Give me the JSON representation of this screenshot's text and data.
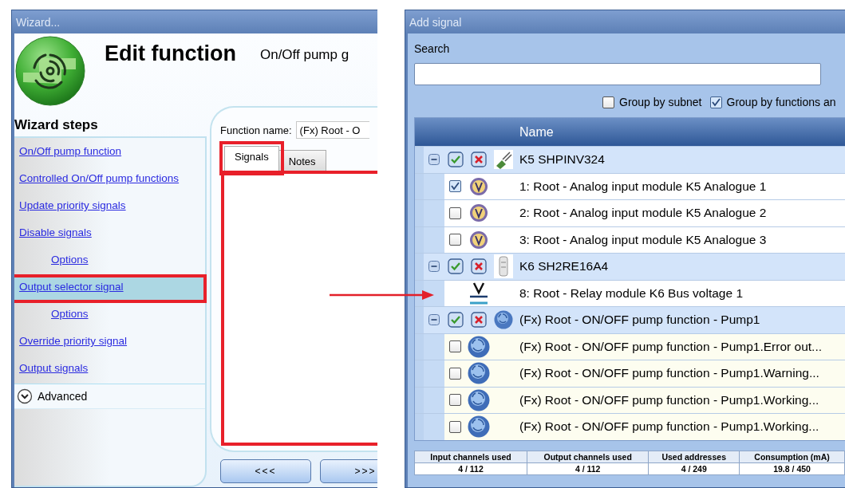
{
  "left_window": {
    "title": "Wizard...",
    "heading": "Edit function",
    "subtitle": "On/Off pump g",
    "steps_heading": "Wizard steps",
    "steps": [
      {
        "label": "On/Off pump function",
        "selected": false,
        "highlighted": false
      },
      {
        "label": "Controlled On/Off pump functions",
        "selected": false,
        "highlighted": false
      },
      {
        "label": "Update priority signals",
        "selected": false,
        "highlighted": false
      },
      {
        "label": "Disable signals",
        "selected": false,
        "highlighted": false,
        "children": [
          {
            "label": "Options",
            "selected": false,
            "highlighted": false
          }
        ]
      },
      {
        "label": "Output selector signal",
        "selected": true,
        "highlighted": true,
        "children": [
          {
            "label": "Options",
            "selected": false,
            "highlighted": false
          }
        ]
      },
      {
        "label": "Override priority signal",
        "selected": false,
        "highlighted": false
      },
      {
        "label": "Output signals",
        "selected": false,
        "highlighted": false
      }
    ],
    "advanced": {
      "label": "Advanced",
      "expanded": false
    },
    "function_name": {
      "label": "Function name:",
      "value": "(Fx) Root - O"
    },
    "tabs": [
      {
        "label": "Signals",
        "selected": true,
        "highlighted": true
      },
      {
        "label": "Notes",
        "selected": false,
        "highlighted": false
      }
    ],
    "signals_list": {
      "highlighted": true
    },
    "buttons": [
      "<<<",
      ">>>"
    ]
  },
  "right_window": {
    "title": "Add signal",
    "search": {
      "label": "Search"
    },
    "group_by": [
      {
        "label": "Group by subnet",
        "checked": false
      },
      {
        "label": "Group by functions an",
        "checked": true
      }
    ],
    "table": {
      "columns": [
        "Name"
      ],
      "groups": [
        {
          "name": "K5 SHPINV324",
          "kind": "module",
          "expanded": true,
          "children": [
            {
              "name": "1: Root - Analog input module K5 Analogue 1",
              "kind": "analog",
              "checked": true
            },
            {
              "name": "2: Root - Analog input module K5 Analogue 2",
              "kind": "analog",
              "checked": false
            },
            {
              "name": "3: Root - Analog input module K5 Analogue 3",
              "kind": "analog",
              "checked": false
            }
          ]
        },
        {
          "name": "K6 SH2RE16A4",
          "kind": "relay",
          "expanded": true,
          "children": [
            {
              "name": "8: Root - Relay module K6 Bus voltage 1",
              "kind": "voltage"
            }
          ]
        },
        {
          "name": "(Fx) Root - ON/OFF pump function - Pump1",
          "kind": "pump",
          "expanded": true,
          "children": [
            {
              "name": "(Fx) Root - ON/OFF pump function - Pump1.Error out...",
              "kind": "pump",
              "checked": false
            },
            {
              "name": "(Fx) Root - ON/OFF pump function - Pump1.Warning...",
              "kind": "pump",
              "checked": false
            },
            {
              "name": "(Fx) Root - ON/OFF pump function - Pump1.Working...",
              "kind": "pump",
              "checked": false
            },
            {
              "name": "(Fx) Root - ON/OFF pump function - Pump1.Working...",
              "kind": "pump",
              "checked": false
            }
          ]
        }
      ]
    },
    "stats": {
      "columns": [
        "Input channels used",
        "Output channels used",
        "Used addresses",
        "Consumption (mA)"
      ],
      "values": [
        "4 / 112",
        "4 / 112",
        "4 / 249",
        "19.8 / 450"
      ]
    }
  }
}
